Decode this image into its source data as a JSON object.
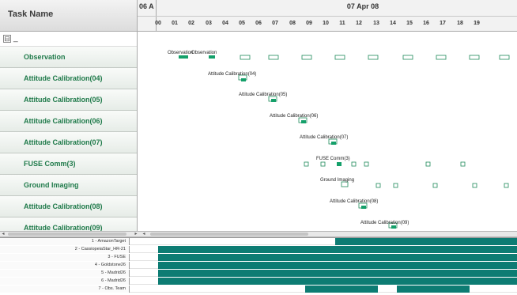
{
  "task_panel": {
    "header_label": "Task Name",
    "group_toggle": "⊟",
    "group_label": "_",
    "tasks": [
      "Observation",
      "Attitude Calibration(04)",
      "Attitude Calibration(05)",
      "Attitude Calibration(06)",
      "Attitude Calibration(07)",
      "FUSE Comm(3)",
      "Ground Imaging",
      "Attitude Calibration(08)",
      "Attitude Calibration(09)"
    ]
  },
  "timeline": {
    "prev_day_label": "06 A",
    "date_label": "07 Apr 08",
    "hours": [
      "00",
      "01",
      "02",
      "03",
      "04",
      "05",
      "06",
      "07",
      "08",
      "09",
      "10",
      "11",
      "12",
      "13",
      "14",
      "15",
      "16",
      "17",
      "18",
      "19"
    ]
  },
  "bar_labels": [
    "Observation",
    "Observation",
    "Attitude Calibration(04)",
    "Attitude Calibration(05)",
    "Attitude Calibration(06)",
    "Attitude Calibration(07)",
    "FUSE Comm(3)",
    "Ground Imaging",
    "Attitude Calibration(08)",
    "Attitude Calibration(09)"
  ],
  "resources": {
    "labels": [
      "1 - AmazonTarget",
      "2 - CassiopeiaStar_HR-21",
      "3 - FUSE",
      "4 - Goldstone26",
      "5 - Madrid26",
      "6 - Madrid26",
      "7 - Obs. Team"
    ]
  },
  "colors": {
    "accent": "#0d7c73",
    "task_label": "#1f7a4a",
    "bar_fill": "#14a06a",
    "placeholder_stroke": "#1f8a5a"
  }
}
